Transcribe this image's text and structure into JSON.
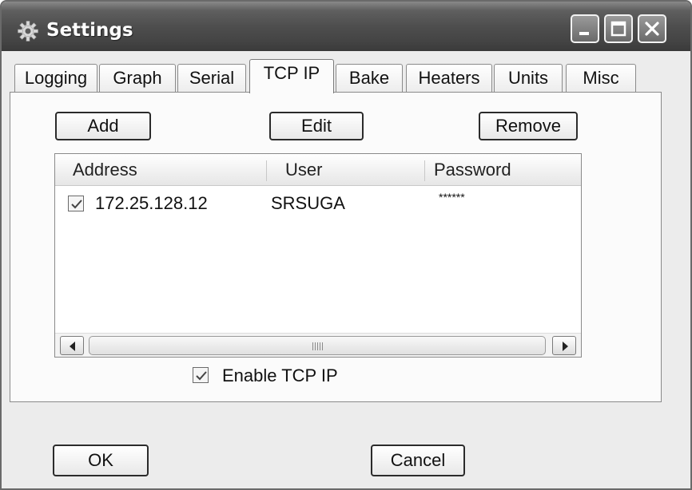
{
  "window": {
    "title": "Settings"
  },
  "tabs": [
    {
      "label": "Logging"
    },
    {
      "label": "Graph"
    },
    {
      "label": "Serial"
    },
    {
      "label": "TCP IP",
      "active": true
    },
    {
      "label": "Bake"
    },
    {
      "label": "Heaters"
    },
    {
      "label": "Units"
    },
    {
      "label": "Misc"
    }
  ],
  "tcpip": {
    "add_label": "Add",
    "edit_label": "Edit",
    "remove_label": "Remove",
    "columns": [
      "Address",
      "User",
      "Password"
    ],
    "rows": [
      {
        "checked": true,
        "address": "172.25.128.12",
        "user": "SRSUGA",
        "password": "******"
      }
    ],
    "enable_label": "Enable TCP IP",
    "enable_checked": true
  },
  "footer": {
    "ok_label": "OK",
    "cancel_label": "Cancel"
  },
  "icons": {
    "title": "gear-icon",
    "min": "minimize-icon",
    "max": "maximize-icon",
    "close": "close-icon"
  },
  "colors": {
    "titlebar": "#4e4e4e",
    "window_bg": "#ececec",
    "page_bg": "#fbfbfb"
  }
}
